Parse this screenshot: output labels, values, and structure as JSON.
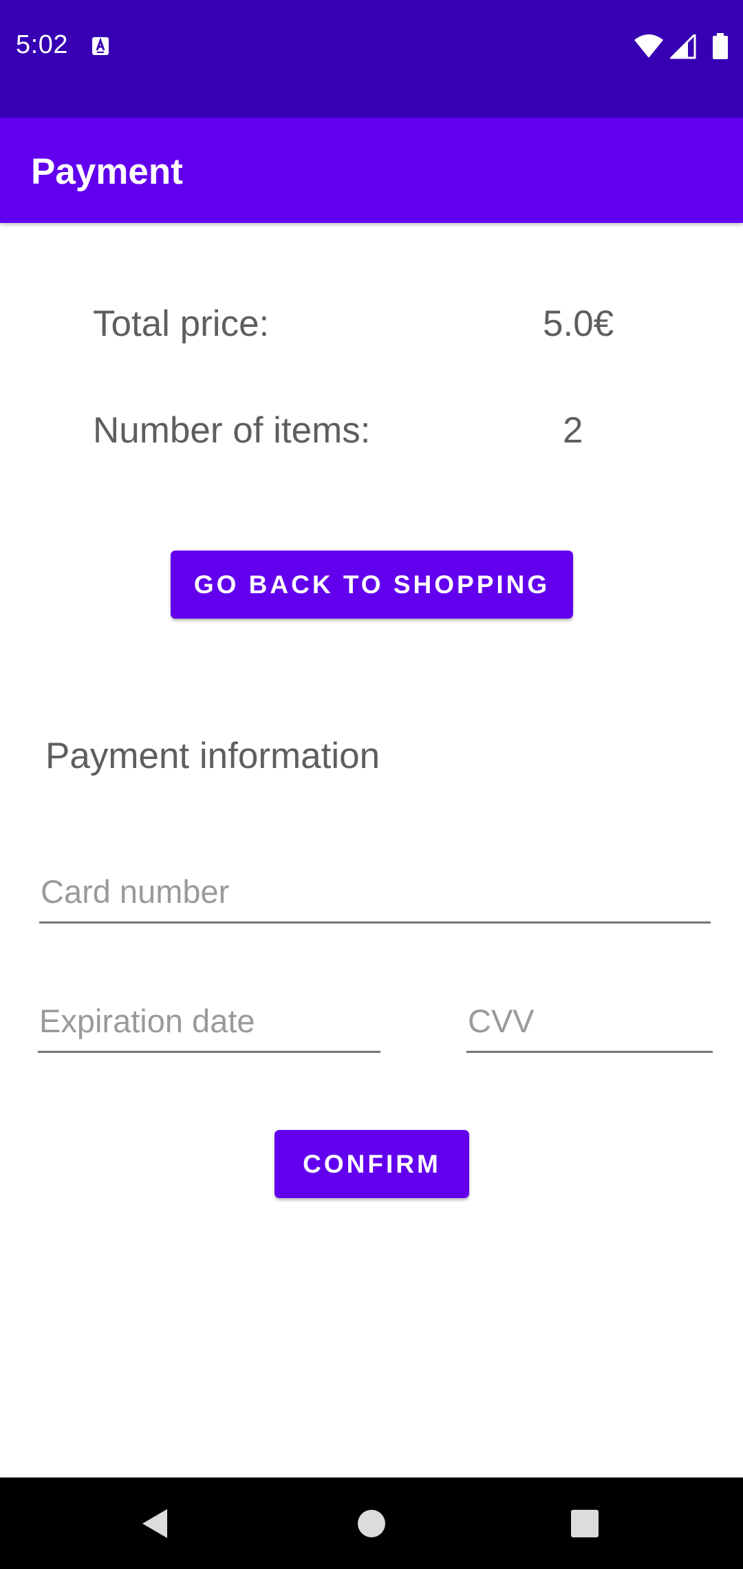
{
  "status_bar": {
    "time": "5:02",
    "color": "#3700b3",
    "icons": [
      "keyboard-notification-icon",
      "wifi-icon",
      "cell-signal-icon",
      "battery-icon"
    ]
  },
  "app_bar": {
    "title": "Payment",
    "color": "#6200ee"
  },
  "summary": {
    "total_price_label": "Total price:",
    "total_price_value": "5.0€",
    "items_label": "Number of items:",
    "items_value": "2"
  },
  "buttons": {
    "back_to_shopping": "GO BACK TO SHOPPING",
    "confirm": "CONFIRM"
  },
  "payment_info": {
    "title": "Payment information",
    "card_number_placeholder": "Card number",
    "card_number_value": "",
    "expiration_placeholder": "Expiration date",
    "expiration_value": "",
    "cvv_placeholder": "CVV",
    "cvv_value": ""
  },
  "nav_bar": {
    "icons": [
      "back-icon",
      "home-icon",
      "recents-icon"
    ]
  }
}
